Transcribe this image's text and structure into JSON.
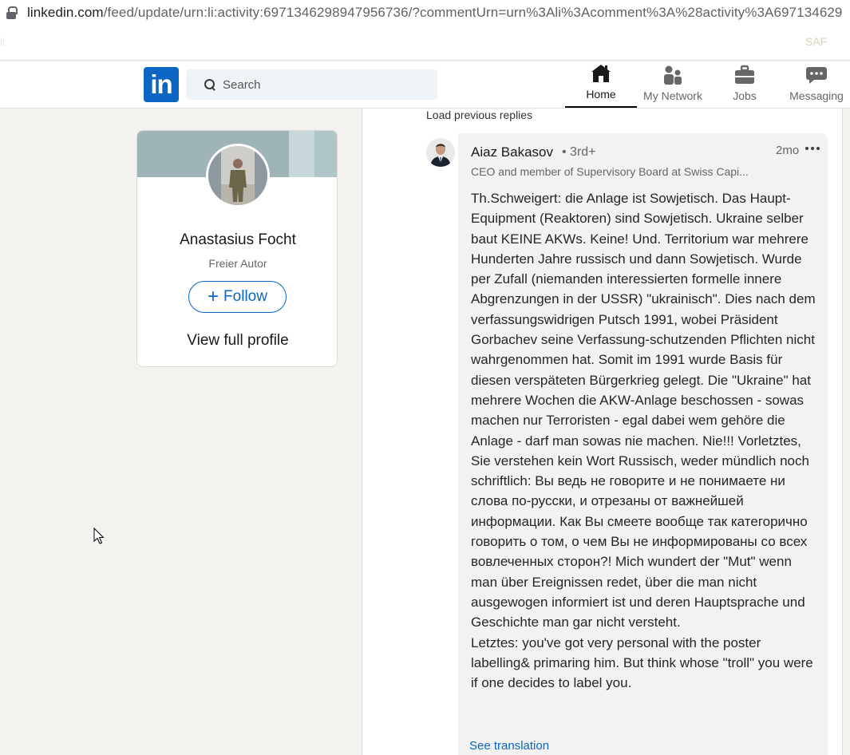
{
  "browser": {
    "url_host": "linkedin.com",
    "url_rest": "/feed/update/urn:li:activity:6971346298947956736/?commentUrn=urn%3Ali%3Acomment%3A%28activity%3A697134629"
  },
  "bookmarks": {
    "left_fragment": "it",
    "right_fragment": "SAF"
  },
  "nav": {
    "search_placeholder": "Search",
    "items": [
      {
        "label": "Home",
        "icon": "home-icon",
        "active": true
      },
      {
        "label": "My Network",
        "icon": "network-icon",
        "active": false
      },
      {
        "label": "Jobs",
        "icon": "briefcase-icon",
        "active": false
      },
      {
        "label": "Messaging",
        "icon": "messaging-icon",
        "active": false
      }
    ]
  },
  "profile_card": {
    "name": "Anastasius Focht",
    "subtitle": "Freier Autor",
    "follow_label": "Follow",
    "view_profile_label": "View full profile"
  },
  "thread": {
    "load_previous": "Load previous replies",
    "see_translation": "See translation",
    "comment": {
      "author": "Aiaz Bakasov",
      "degree": "• 3rd+",
      "time": "2mo",
      "headline": "CEO and member of Supervisory Board at Swiss Capi...",
      "paragraphs": [
        "Th.Schweigert: die Anlage ist Sowjetisch. Das Haupt-Equipment (Reaktoren) sind Sowjetisch. Ukraine selber baut KEINE AKWs. Keine! Und. Territorium war mehrere Hunderten Jahre russisch und dann Sowjetisch. Wurde per Zufall (niemanden interessierten formelle innere Abgrenzungen in der USSR) \"ukrainisch\". Dies nach dem verfassungswidrigen Putsch 1991, wobei Präsident Gorbachev seine Verfassung-schutzenden Pflichten nicht wahrgenommen hat. Somit im 1991 wurde Basis für diesen verspäteten Bürgerkrieg gelegt. Die \"Ukraine\" hat mehrere Wochen die AKW-Anlage beschossen - sowas machen nur Terroristen - egal dabei wem gehöre die Anlage - darf man sowas nie machen. Nie!!! Vorletztes, Sie verstehen kein Wort Russisch, weder mündlich noch schriftlich: Вы ведь не говорите и не понимаете ни слова по-русски, и отрезаны от важнейшей информации. Как Вы смеете вообще так категорично говорить о том, о чем Вы не информированы со всех вовлеченных сторон?! Mich wundert der \"Mut\" wenn man über Ereignissen redet, über die man nicht ausgewogen informiert ist und deren Hauptsprache und Geschichte man gar nicht versteht.",
        "Letztes: you've got very personal with the poster labelling& primaring him. But think whose \"troll\" you were if one decides to label you."
      ]
    }
  },
  "colors": {
    "brand": "#0a66c2",
    "page_bg": "#f3f2ef",
    "bubble_bg": "#f2f2f2"
  }
}
